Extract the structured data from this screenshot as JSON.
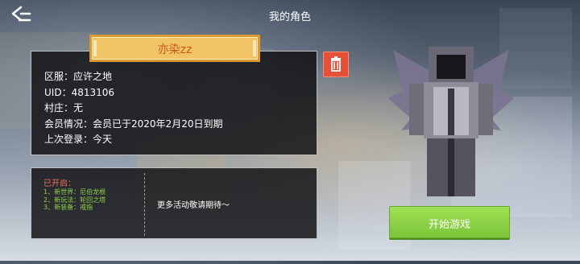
{
  "header": {
    "title": "我的角色"
  },
  "profile": {
    "name": "亦染zz",
    "server_label": "区服：",
    "server_value": "应许之地",
    "uid_label": "UID：",
    "uid_value": "4813106",
    "village_label": "村庄：",
    "village_value": "无",
    "member_label": "会员情况：",
    "member_value": "会员已于2020年2月20日到期",
    "last_login_label": "上次登录：",
    "last_login_value": "今天"
  },
  "features": {
    "opened_title": "已开启：",
    "items": [
      "1、新世界：尼伯龙根",
      "2、新玩法：轮回之塔",
      "3、新装备：戒指"
    ],
    "more_text": "更多活动敬请期待～"
  },
  "actions": {
    "start_label": "开始游戏"
  },
  "icons": {
    "back": "back-arrow-icon",
    "delete": "trash-icon"
  },
  "colors": {
    "banner_bg": "#f0c366",
    "banner_text": "#c75a16",
    "delete_bg": "#e65038",
    "start_bg": "#8fd14d",
    "opened_title": "#f36d5e",
    "opened_items": "#8fd14d"
  }
}
